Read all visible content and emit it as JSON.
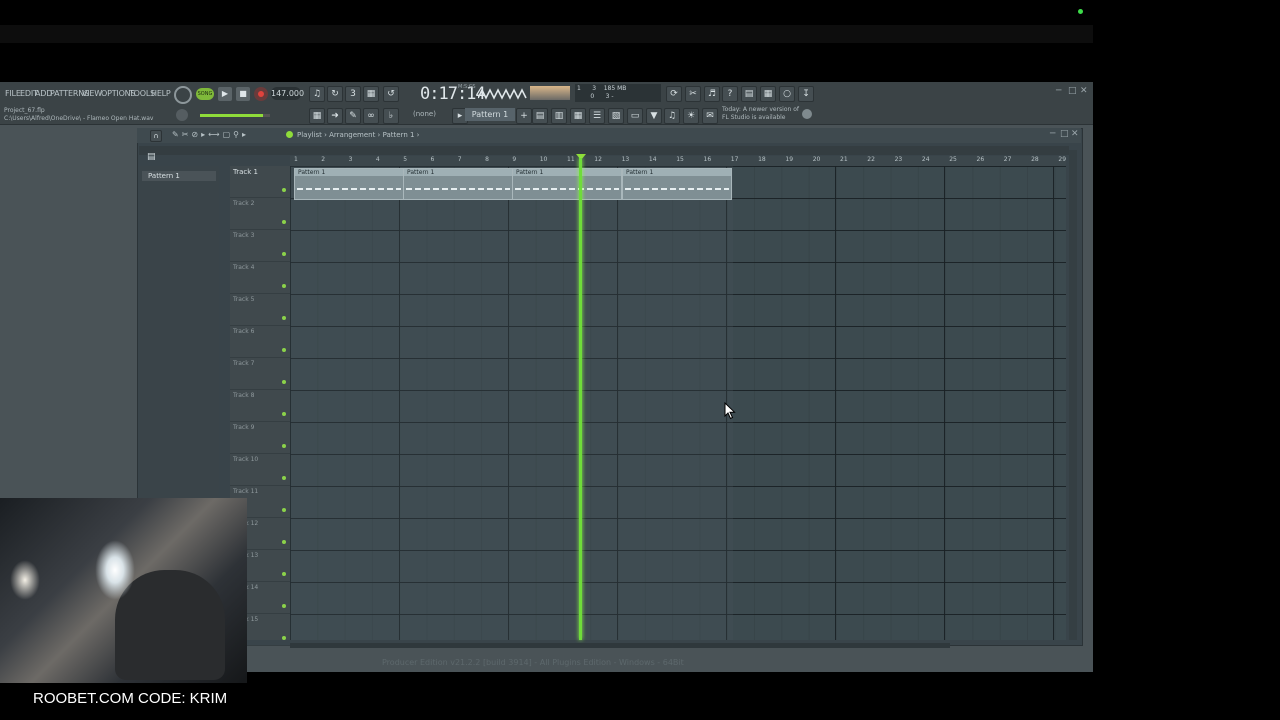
{
  "menu": {
    "items": [
      "FILE",
      "EDIT",
      "ADD",
      "PATTERNS",
      "VIEW",
      "OPTIONS",
      "TOOLS",
      "HELP"
    ]
  },
  "transport": {
    "song_mode": "SONG",
    "tempo": "147.000",
    "time": "0:17:14",
    "time_label": "M:S:CS"
  },
  "cpu": {
    "line1": "1      3    185 MB",
    "line2": "       0      3 -"
  },
  "project": {
    "name": "Project_67.flp",
    "path": "C:\\Users\\Alfred\\OneDrive\\ - Flameo Open Hat.wav"
  },
  "toolbar": {
    "none_label": "(none)",
    "pattern_label": "Pattern 1",
    "hint": "Today: A newer version of FL Studio is available"
  },
  "playlist": {
    "breadcrumb": "Playlist › Arrangement › Pattern 1 ›",
    "sidebar_item": "Pattern 1",
    "ruler": [
      "1",
      "2",
      "3",
      "4",
      "5",
      "6",
      "7",
      "8",
      "9",
      "10",
      "11",
      "12",
      "13",
      "14",
      "15",
      "16",
      "17",
      "18",
      "19",
      "20",
      "21",
      "22",
      "23",
      "24",
      "25",
      "26",
      "27",
      "28",
      "29"
    ],
    "tracks": [
      "Track 1",
      "Track 2",
      "Track 3",
      "Track 4",
      "Track 5",
      "Track 6",
      "Track 7",
      "Track 8",
      "Track 9",
      "Track 10",
      "Track 11",
      "Track 12",
      "Track 13",
      "Track 14",
      "Track 15"
    ],
    "clips": [
      "Pattern 1",
      "Pattern 1",
      "Pattern 1",
      "Pattern 1"
    ]
  },
  "status_bar": "Producer Edition v21.2.2 [build 3914] - All Plugins Edition - Windows - 64Bit",
  "overlay": {
    "text": "ROOBET.COM CODE: KRIM"
  },
  "colors": {
    "accent": "#6fdc3a",
    "panel": "#3c4a4f",
    "background": "#000000"
  }
}
